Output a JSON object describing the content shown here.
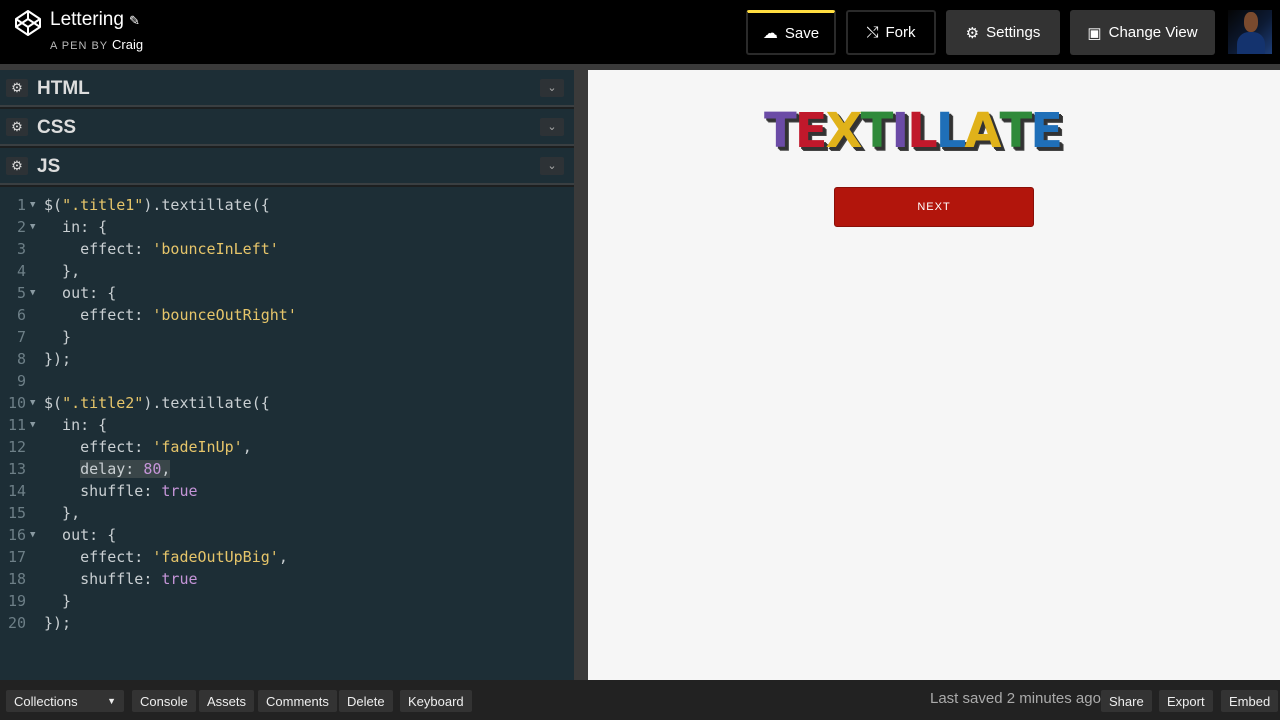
{
  "header": {
    "title": "Lettering",
    "pen_by_prefix": "A PEN BY",
    "author": "Craig",
    "buttons": {
      "save": "Save",
      "fork": "Fork",
      "settings": "Settings",
      "change_view": "Change View"
    }
  },
  "editors": {
    "html_label": "HTML",
    "css_label": "CSS",
    "js_label": "JS"
  },
  "code": {
    "lines": [
      {
        "n": "1",
        "segs": [
          {
            "t": "$(",
            "c": "key"
          },
          {
            "t": "\".title1\"",
            "c": "str"
          },
          {
            "t": ").textillate({",
            "c": "key"
          }
        ]
      },
      {
        "n": "2",
        "segs": [
          {
            "t": "  in: {",
            "c": "key"
          }
        ]
      },
      {
        "n": "3",
        "segs": [
          {
            "t": "    effect: ",
            "c": "key"
          },
          {
            "t": "'bounceInLeft'",
            "c": "str"
          }
        ]
      },
      {
        "n": "4",
        "segs": [
          {
            "t": "  },",
            "c": "key"
          }
        ]
      },
      {
        "n": "5",
        "segs": [
          {
            "t": "  out: {",
            "c": "key"
          }
        ]
      },
      {
        "n": "6",
        "segs": [
          {
            "t": "    effect: ",
            "c": "key"
          },
          {
            "t": "'bounceOutRight'",
            "c": "str"
          }
        ]
      },
      {
        "n": "7",
        "segs": [
          {
            "t": "  }",
            "c": "key"
          }
        ]
      },
      {
        "n": "8",
        "segs": [
          {
            "t": "});",
            "c": "key"
          }
        ]
      },
      {
        "n": "9",
        "segs": []
      },
      {
        "n": "10",
        "segs": [
          {
            "t": "$(",
            "c": "key"
          },
          {
            "t": "\".title2\"",
            "c": "str"
          },
          {
            "t": ").textillate({",
            "c": "key"
          }
        ]
      },
      {
        "n": "11",
        "segs": [
          {
            "t": "  in: {",
            "c": "key"
          }
        ]
      },
      {
        "n": "12",
        "segs": [
          {
            "t": "    effect: ",
            "c": "key"
          },
          {
            "t": "'fadeInUp'",
            "c": "str"
          },
          {
            "t": ",",
            "c": "key"
          }
        ]
      },
      {
        "n": "13",
        "segs": [
          {
            "t": "    ",
            "c": "key"
          },
          {
            "t": "delay: ",
            "c": "key hl"
          },
          {
            "t": "80",
            "c": "num hl"
          },
          {
            "t": ",",
            "c": "key hl"
          }
        ]
      },
      {
        "n": "14",
        "segs": [
          {
            "t": "    shuffle: ",
            "c": "key"
          },
          {
            "t": "true",
            "c": "bool"
          }
        ]
      },
      {
        "n": "15",
        "segs": [
          {
            "t": "  },",
            "c": "key"
          }
        ]
      },
      {
        "n": "16",
        "segs": [
          {
            "t": "  out: {",
            "c": "key"
          }
        ]
      },
      {
        "n": "17",
        "segs": [
          {
            "t": "    effect: ",
            "c": "key"
          },
          {
            "t": "'fadeOutUpBig'",
            "c": "str"
          },
          {
            "t": ",",
            "c": "key"
          }
        ]
      },
      {
        "n": "18",
        "segs": [
          {
            "t": "    shuffle: ",
            "c": "key"
          },
          {
            "t": "true",
            "c": "bool"
          }
        ]
      },
      {
        "n": "19",
        "segs": [
          {
            "t": "  }",
            "c": "key"
          }
        ]
      },
      {
        "n": "20",
        "segs": [
          {
            "t": "});",
            "c": "key"
          }
        ]
      }
    ],
    "foldable_lines": [
      "1",
      "2",
      "5",
      "10",
      "11",
      "16"
    ]
  },
  "preview": {
    "title_letters": [
      {
        "ch": "T",
        "color": "#6b4ba6"
      },
      {
        "ch": "E",
        "color": "#c0182b"
      },
      {
        "ch": "X",
        "color": "#e0b21a"
      },
      {
        "ch": "T",
        "color": "#2f8a3a"
      },
      {
        "ch": "I",
        "color": "#6b4ba6"
      },
      {
        "ch": "L",
        "color": "#c0182b"
      },
      {
        "ch": "L",
        "color": "#1f6fb8"
      },
      {
        "ch": "A",
        "color": "#e0b21a"
      },
      {
        "ch": "T",
        "color": "#2f8a3a"
      },
      {
        "ch": "E",
        "color": "#1f6fb8"
      }
    ],
    "next_button": "NEXT"
  },
  "footer": {
    "collections": "Collections",
    "console": "Console",
    "assets": "Assets",
    "comments": "Comments",
    "delete": "Delete",
    "keyboard": "Keyboard",
    "last_saved": "Last saved 2 minutes ago",
    "share": "Share",
    "export": "Export",
    "embed": "Embed"
  }
}
